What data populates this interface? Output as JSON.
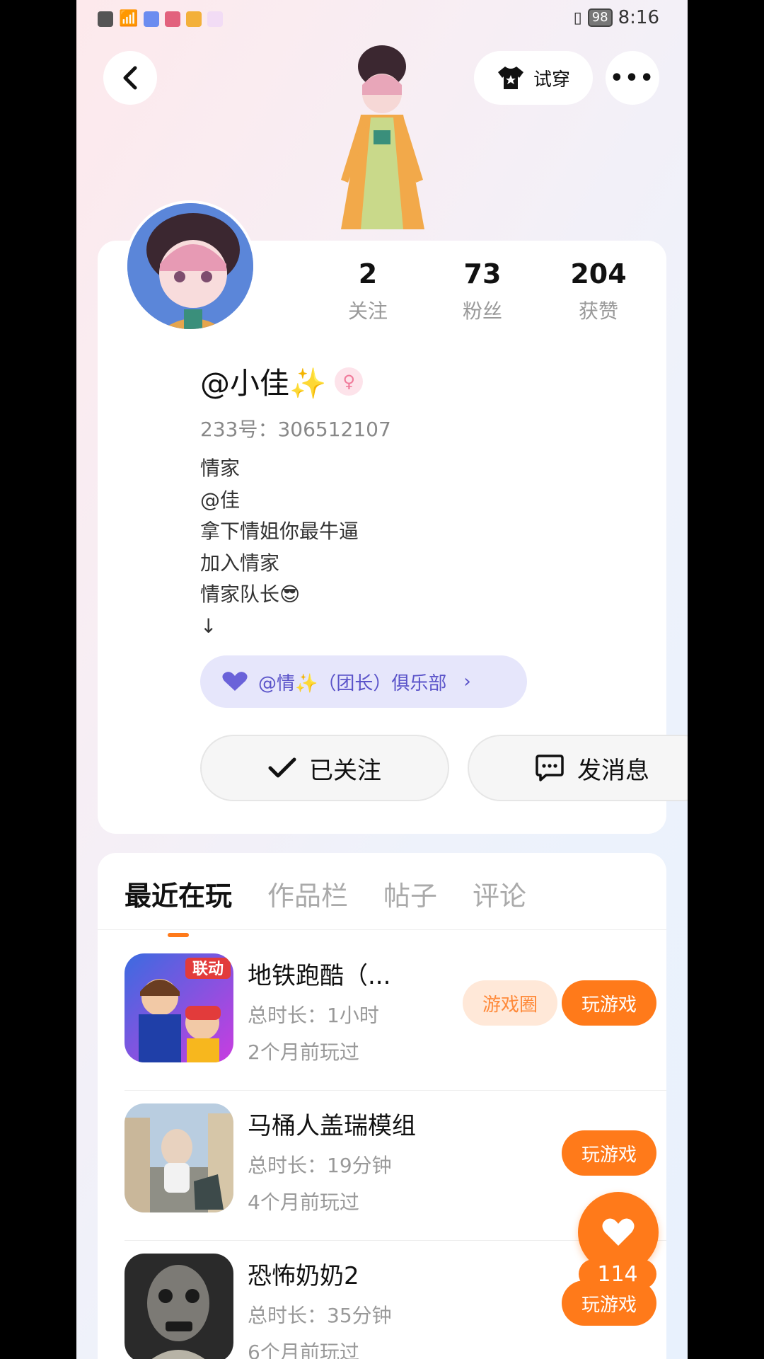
{
  "status_bar": {
    "time": "8:16",
    "battery": "98"
  },
  "header": {
    "try_on_label": "试穿",
    "more_label": "•••"
  },
  "profile": {
    "stats": [
      {
        "value": "2",
        "label": "关注"
      },
      {
        "value": "73",
        "label": "粉丝"
      },
      {
        "value": "204",
        "label": "获赞"
      }
    ],
    "nickname": "@小佳✨",
    "uid": "233号：306512107",
    "bio": [
      "情家",
      "@佳",
      "拿下情姐你最牛逼",
      "加入情家",
      "情家队长😎",
      "↓"
    ],
    "club_label": "@情✨（团长）俱乐部",
    "follow_label": "已关注",
    "message_label": "发消息"
  },
  "tabs": [
    "最近在玩",
    "作品栏",
    "帖子",
    "评论"
  ],
  "games": [
    {
      "name": "地铁跑酷（...",
      "duration": "总时长：1小时",
      "last_played": "2个月前玩过",
      "circle_label": "游戏圈",
      "play_label": "玩游戏"
    },
    {
      "name": "马桶人盖瑞模组",
      "duration": "总时长：19分钟",
      "last_played": "4个月前玩过",
      "play_label": "玩游戏"
    },
    {
      "name": "恐怖奶奶2",
      "duration": "总时长：35分钟",
      "last_played": "6个月前玩过",
      "play_label": "玩游戏"
    }
  ],
  "like": {
    "count": "114"
  },
  "colors": {
    "accent": "#ff7a1a",
    "club_bg": "#e6e6fb",
    "club_text": "#5a53c9"
  }
}
